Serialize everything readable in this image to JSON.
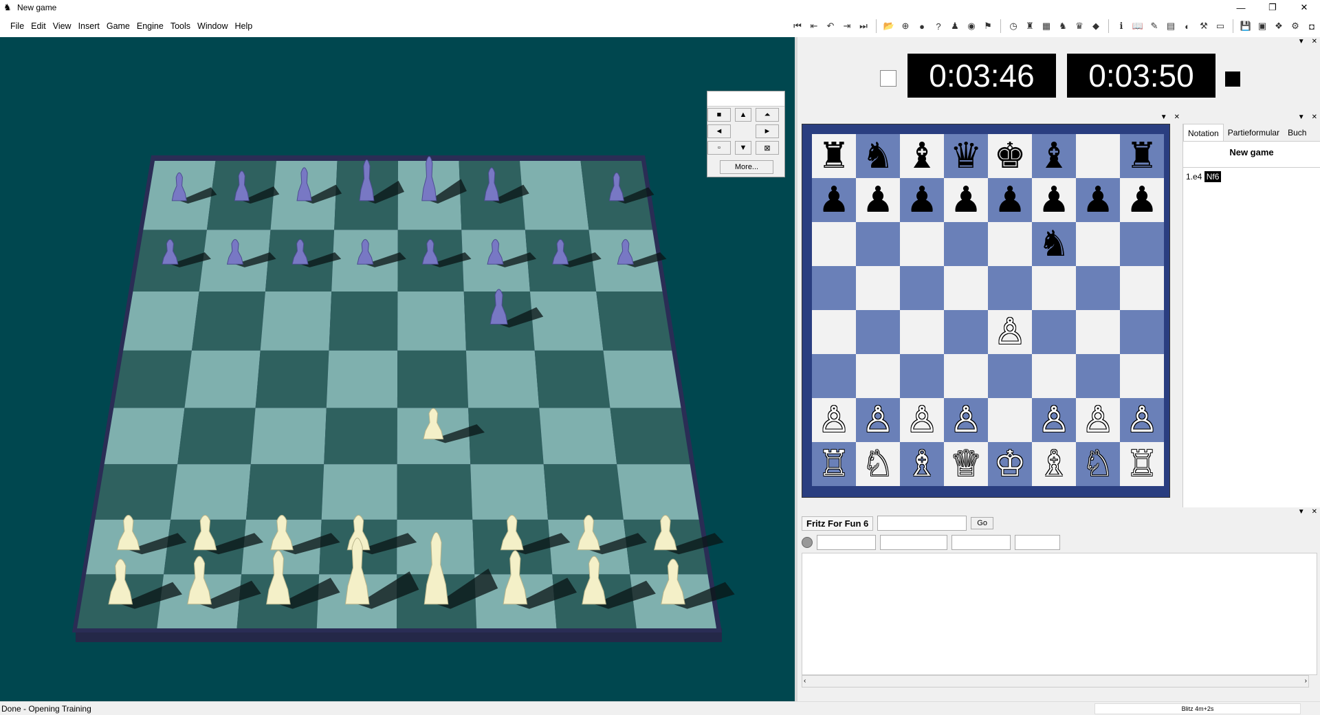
{
  "window": {
    "title": "New game",
    "minimize": "—",
    "maximize": "❐",
    "close": "✕"
  },
  "menu": [
    "File",
    "Edit",
    "View",
    "Insert",
    "Game",
    "Engine",
    "Tools",
    "Window",
    "Help"
  ],
  "toolbar": {
    "icons": [
      "first-move-icon",
      "back-icon",
      "back-one-icon",
      "forward-icon",
      "last-move-icon",
      "open-icon",
      "globe-icon",
      "bulb-icon",
      "hint-icon",
      "figure-icon",
      "ball-icon",
      "flag-icon",
      "clock-icon",
      "engine-icon",
      "board-icon",
      "chess-icon",
      "coach-icon",
      "power-icon",
      "info-icon",
      "book-icon",
      "pen-icon",
      "grid-icon",
      "eye-icon",
      "tool-icon",
      "window-icon",
      "save-icon",
      "setup-icon",
      "cube-icon",
      "settings-icon"
    ]
  },
  "nav3d": {
    "more": "More..."
  },
  "clocks": {
    "white": "0:03:46",
    "black": "0:03:50"
  },
  "board2d": {
    "ranks": [
      [
        "♜",
        "♞",
        "♝",
        "♛",
        "♚",
        "♝",
        "",
        "♜"
      ],
      [
        "♟",
        "♟",
        "♟",
        "♟",
        "♟",
        "♟",
        "♟",
        "♟"
      ],
      [
        "",
        "",
        "",
        "",
        "",
        "♞",
        "",
        ""
      ],
      [
        "",
        "",
        "",
        "",
        "",
        "",
        "",
        ""
      ],
      [
        "",
        "",
        "",
        "",
        "♙",
        "",
        "",
        ""
      ],
      [
        "",
        "",
        "",
        "",
        "",
        "",
        "",
        ""
      ],
      [
        "♙",
        "♙",
        "♙",
        "♙",
        "",
        "♙",
        "♙",
        "♙"
      ],
      [
        "♖",
        "♘",
        "♗",
        "♕",
        "♔",
        "♗",
        "♘",
        "♖"
      ]
    ]
  },
  "notation": {
    "tabs": [
      "Notation",
      "Partieformular",
      "Buch"
    ],
    "game_title": "New game",
    "move1": "1.e4",
    "move2": "Nf6"
  },
  "engine": {
    "name": "Fritz For Fun 6",
    "go": "Go"
  },
  "status": {
    "left": "Done - Opening Training",
    "right": "Blitz 4m+2s"
  }
}
